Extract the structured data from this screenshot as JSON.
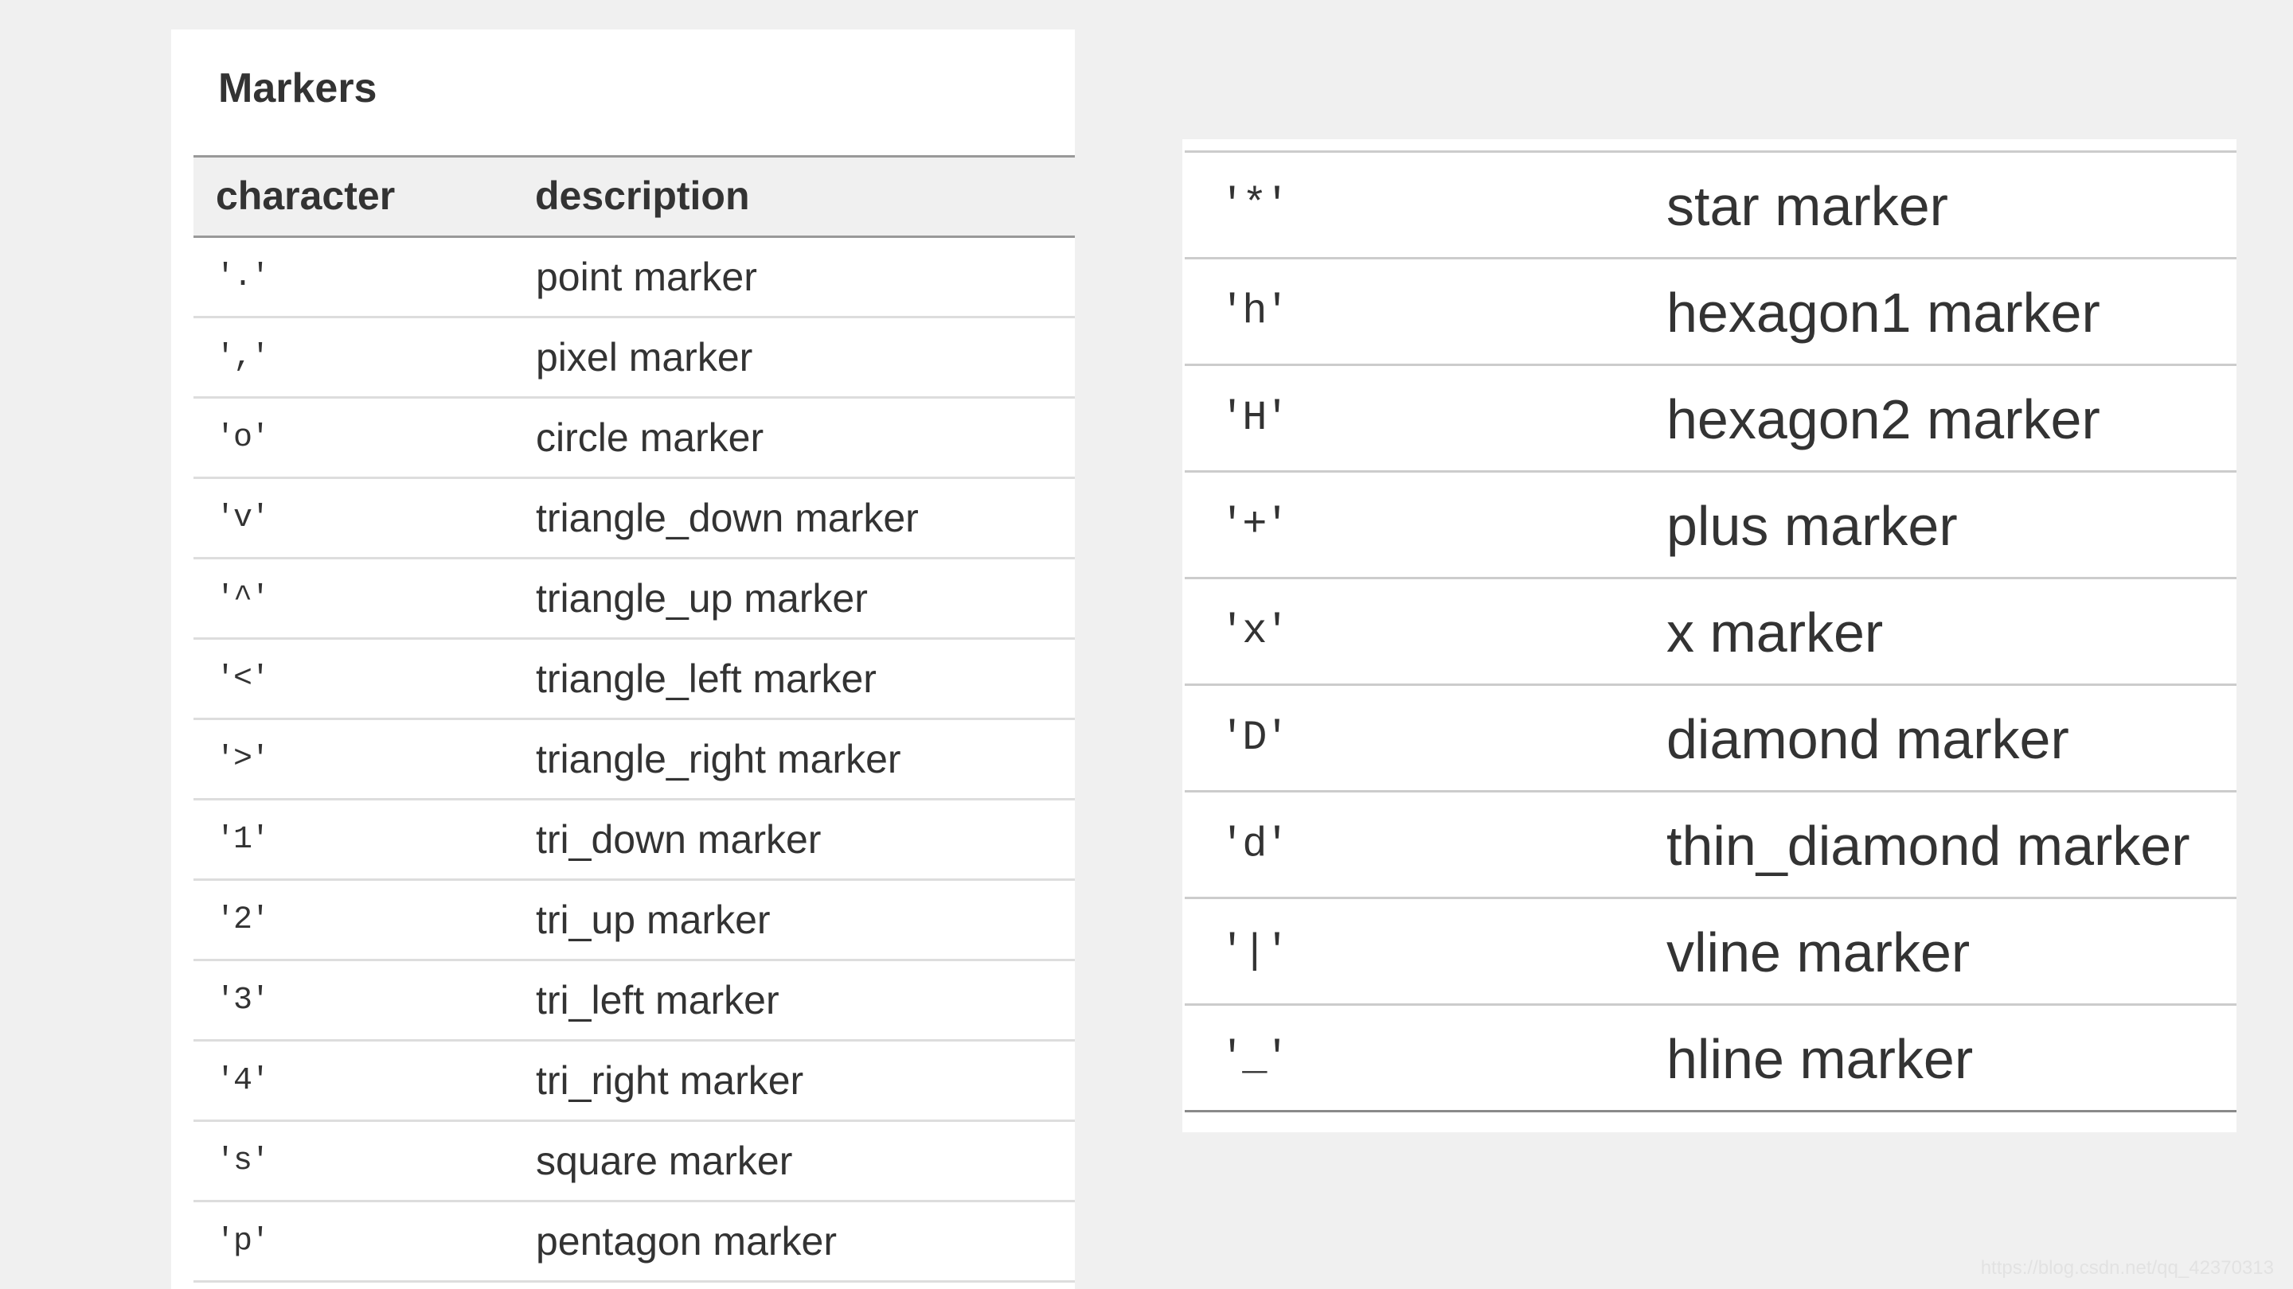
{
  "left_panel": {
    "title": "Markers",
    "headers": {
      "character": "character",
      "description": "description"
    },
    "rows": [
      {
        "character": "'.'",
        "description": "point marker"
      },
      {
        "character": "','",
        "description": "pixel marker"
      },
      {
        "character": "'o'",
        "description": "circle marker"
      },
      {
        "character": "'v'",
        "description": "triangle_down marker"
      },
      {
        "character": "'^'",
        "description": "triangle_up marker"
      },
      {
        "character": "'<'",
        "description": "triangle_left marker"
      },
      {
        "character": "'>'",
        "description": "triangle_right marker"
      },
      {
        "character": "'1'",
        "description": "tri_down marker"
      },
      {
        "character": "'2'",
        "description": "tri_up marker"
      },
      {
        "character": "'3'",
        "description": "tri_left marker"
      },
      {
        "character": "'4'",
        "description": "tri_right marker"
      },
      {
        "character": "'s'",
        "description": "square marker"
      },
      {
        "character": "'p'",
        "description": "pentagon marker"
      }
    ]
  },
  "right_panel": {
    "rows": [
      {
        "character": "'*'",
        "description": "star marker"
      },
      {
        "character": "'h'",
        "description": "hexagon1 marker"
      },
      {
        "character": "'H'",
        "description": "hexagon2 marker"
      },
      {
        "character": "'+'",
        "description": "plus marker"
      },
      {
        "character": "'x'",
        "description": "x marker"
      },
      {
        "character": "'D'",
        "description": "diamond marker"
      },
      {
        "character": "'d'",
        "description": "thin_diamond marker"
      },
      {
        "character": "'|'",
        "description": "vline marker"
      },
      {
        "character": "'_'",
        "description": "hline marker"
      }
    ]
  },
  "watermark": "https://blog.csdn.net/qq_42370313"
}
